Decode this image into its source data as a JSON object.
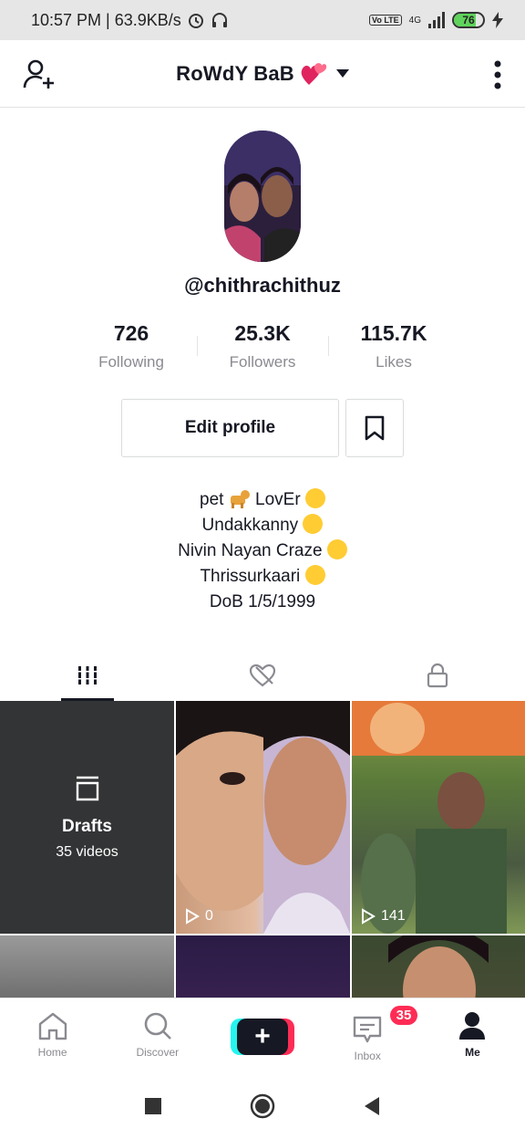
{
  "status_bar": {
    "time": "10:57 PM | 63.9KB/s",
    "network": "4G",
    "volte": "Vo LTE",
    "battery": "76",
    "battery_level": 0.76
  },
  "header": {
    "title": "RoWdY BaB",
    "add_user_icon": "add-user-icon",
    "more_icon": "more-vertical-icon"
  },
  "profile": {
    "username": "@chithrachithuz",
    "stats": [
      {
        "value": "726",
        "label": "Following"
      },
      {
        "value": "25.3K",
        "label": "Followers"
      },
      {
        "value": "115.7K",
        "label": "Likes"
      }
    ],
    "edit_label": "Edit profile",
    "bio": [
      "pet",
      "LovEr",
      "Undakkanny",
      "Nivin Nayan Craze",
      "Thrissurkaari",
      "DoB 1/5/1999"
    ]
  },
  "tabs": [
    {
      "icon": "grid-icon",
      "active": true
    },
    {
      "icon": "liked-hidden-icon",
      "active": false
    },
    {
      "icon": "lock-icon",
      "active": false
    }
  ],
  "grid": {
    "drafts_title": "Drafts",
    "drafts_count": "35 videos",
    "videos": [
      {
        "views": "0"
      },
      {
        "views": "141"
      }
    ]
  },
  "bottom_nav": {
    "items": [
      {
        "label": "Home",
        "icon": "home-icon"
      },
      {
        "label": "Discover",
        "icon": "search-icon"
      },
      {
        "label": "",
        "icon": "create-plus-icon"
      },
      {
        "label": "Inbox",
        "icon": "inbox-icon"
      },
      {
        "label": "Me",
        "icon": "profile-icon"
      }
    ],
    "inbox_badge": "35"
  },
  "colors": {
    "accent": "#fe2c55",
    "cyan": "#25f4ee",
    "text": "#161823",
    "muted": "#8a8b91"
  }
}
